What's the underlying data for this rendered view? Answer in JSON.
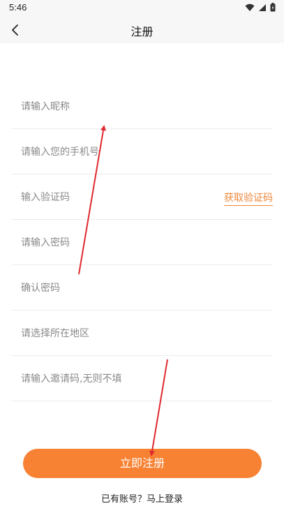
{
  "status_bar": {
    "time": "5:46",
    "icons": [
      "wifi-icon",
      "signal-icon",
      "battery-icon"
    ]
  },
  "nav": {
    "title": "注册",
    "back_icon": "chevron-left-icon"
  },
  "form": {
    "nickname_placeholder": "请输入昵称",
    "phone_placeholder": "请输入您的手机号",
    "code_placeholder": "输入验证码",
    "get_code_label": "获取验证码",
    "password_placeholder": "请输入密码",
    "confirm_password_placeholder": "确认密码",
    "region_placeholder": "请选择所在地区",
    "invite_placeholder": "请输入邀请码,无则不填"
  },
  "actions": {
    "submit_label": "立即注册",
    "login_link": "已有账号？马上登录"
  },
  "colors": {
    "accent": "#f78233",
    "link": "#f0883a",
    "annotation_arrow": "#e0282e"
  }
}
